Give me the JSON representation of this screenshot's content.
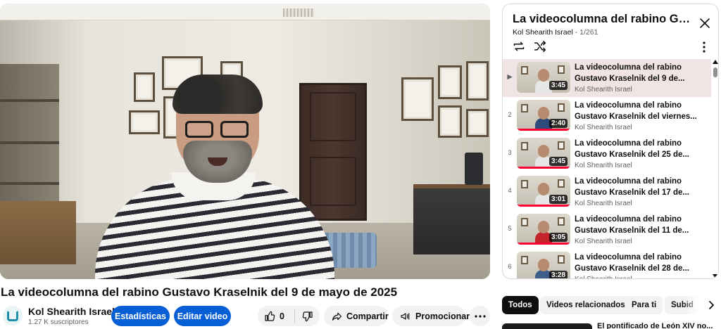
{
  "video": {
    "title": "La videocolumna del rabino Gustavo Kraselnik del 9 de mayo de 2025"
  },
  "channel": {
    "name": "Kol Shearith Israel",
    "subscribers": "1.27 K suscriptores"
  },
  "actions": {
    "stats_label": "Estadísticas",
    "edit_label": "Editar video",
    "likes": "0",
    "share_label": "Compartir",
    "promote_label": "Promocionar"
  },
  "playlist": {
    "title": "La videocolumna del rabino Gustavo Kraselnik",
    "channel": "Kol Shearith Israel",
    "separator": "-",
    "position": "1/261",
    "items": [
      {
        "index": "▶",
        "line1": "La videocolumna del rabino",
        "line2": "Gustavo Kraselnik del 9 de...",
        "duration": "3:45",
        "channel": "Kol Shearith Israel",
        "active": true
      },
      {
        "index": "2",
        "line1": "La videocolumna del rabino",
        "line2": "Gustavo Kraselnik del viernes...",
        "duration": "2:40",
        "channel": "Kol Shearith Israel"
      },
      {
        "index": "3",
        "line1": "La videocolumna del rabino",
        "line2": "Gustavo Kraselnik del 25 de...",
        "duration": "3:45",
        "channel": "Kol Shearith Israel"
      },
      {
        "index": "4",
        "line1": "La videocolumna del rabino",
        "line2": "Gustavo Kraselnik del 17 de...",
        "duration": "3:01",
        "channel": "Kol Shearith Israel"
      },
      {
        "index": "5",
        "line1": "La videocolumna del rabino",
        "line2": "Gustavo Kraselnik del 11 de...",
        "duration": "3:05",
        "channel": "Kol Shearith Israel"
      },
      {
        "index": "6",
        "line1": "La videocolumna del rabino",
        "line2": "Gustavo Kraselnik del 28 de...",
        "duration": "3:28",
        "channel": "Kol Shearith Israel"
      }
    ]
  },
  "chips": [
    "Todos",
    "Videos relacionados",
    "Para ti",
    "Subid"
  ],
  "next_video": {
    "title": "El pontificado de León XIV no..."
  },
  "icons": {
    "close": "close-icon",
    "loop": "loop-icon",
    "shuffle": "shuffle-icon",
    "more": "more-vertical-icon",
    "like": "thumbs-up-icon",
    "dislike": "thumbs-down-icon",
    "share": "share-icon",
    "promote": "megaphone-icon",
    "more_horizontal": "more-horizontal-icon",
    "chevron": "chevron-right-icon"
  },
  "colors": {
    "accent": "#065fd4",
    "progress": "#ff0033",
    "active_row": "#f0e4e4"
  }
}
